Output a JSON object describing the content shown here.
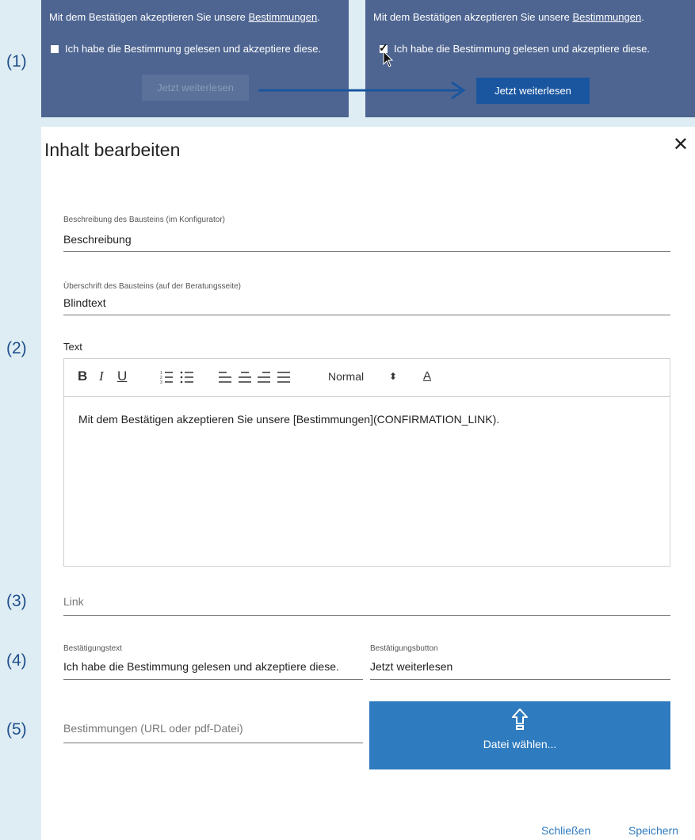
{
  "step_labels": [
    "(1)",
    "(2)",
    "(3)",
    "(4)",
    "(5)"
  ],
  "preview": {
    "text_prefix": "Mit dem Bestätigen akzeptieren Sie unsere ",
    "link": "Bestimmungen",
    "text_suffix": ".",
    "checkbox_label": "Ich habe die Bestimmung gelesen und akzeptiere diese.",
    "button": "Jetzt weiterlesen",
    "colors": {
      "panel": "#4e6591",
      "button_disabled": "#5b7199",
      "button_active": "#1a56a0",
      "arrow": "#1a56a0"
    }
  },
  "dialog": {
    "title": "Inhalt bearbeiten",
    "close_icon": "close-icon",
    "fields": {
      "beschreibung": {
        "label": "Beschreibung des Bausteins (im Konfigurator)",
        "value": "Beschreibung"
      },
      "ueberschrift": {
        "label": "Überschrift des Bausteins (auf der Beratungsseite)",
        "value": "Blindtext"
      },
      "text_label": "Text",
      "link_placeholder": "Link",
      "bestaetigungstext": {
        "label": "Bestätigungstext",
        "value": "Ich habe die Bestimmung gelesen und akzeptiere diese."
      },
      "bestaetigungsbutton": {
        "label": "Bestätigungsbutton",
        "value": "Jetzt weiterlesen"
      },
      "bestimmungen_placeholder": "Bestimmungen (URL oder pdf-Datei)"
    },
    "editor": {
      "toolbar": {
        "bold": "B",
        "italic": "I",
        "underline": "U",
        "header_select": "Normal",
        "select_arrow": "⬍",
        "color": "A"
      },
      "content": "Mit dem Bestätigen akzeptieren Sie unsere [Bestimmungen](CONFIRMATION_LINK)."
    },
    "upload": {
      "label": "Datei wählen...",
      "icon": "upload-arrow-icon",
      "color": "#2e7bbf"
    },
    "footer": {
      "close": "Schließen",
      "save": "Speichern"
    }
  }
}
